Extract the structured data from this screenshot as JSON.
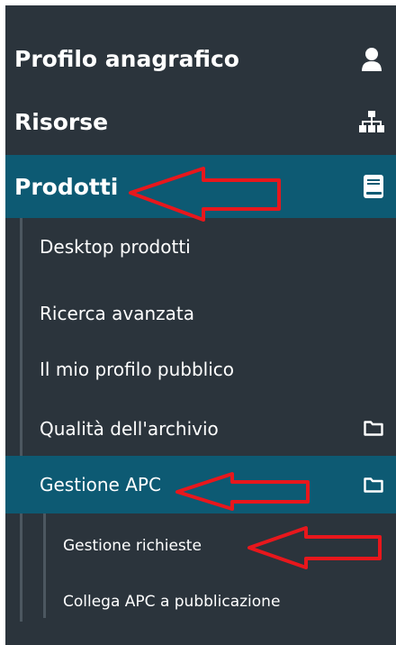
{
  "menu": {
    "profilo_label": "Profilo anagrafico",
    "risorse_label": "Risorse",
    "prodotti_label": "Prodotti",
    "prodotti_icon": "book-icon",
    "profilo_icon": "user-icon",
    "risorse_icon": "sitemap-icon",
    "prodotti_items": [
      {
        "label": "Desktop prodotti"
      },
      {
        "label": "Ricerca avanzata"
      },
      {
        "label": "Il mio profilo pubblico"
      },
      {
        "label": "Qualità dell'archivio",
        "icon": "folder-icon"
      },
      {
        "label": "Gestione APC",
        "icon": "folder-icon"
      }
    ],
    "apc_items": [
      {
        "label": "Gestione richieste"
      },
      {
        "label": "Collega APC a pubblicazione"
      }
    ]
  },
  "colors": {
    "panel_bg": "#2b343c",
    "active_bg": "#0d5a73",
    "annotation_arrow": "#e8171c"
  }
}
